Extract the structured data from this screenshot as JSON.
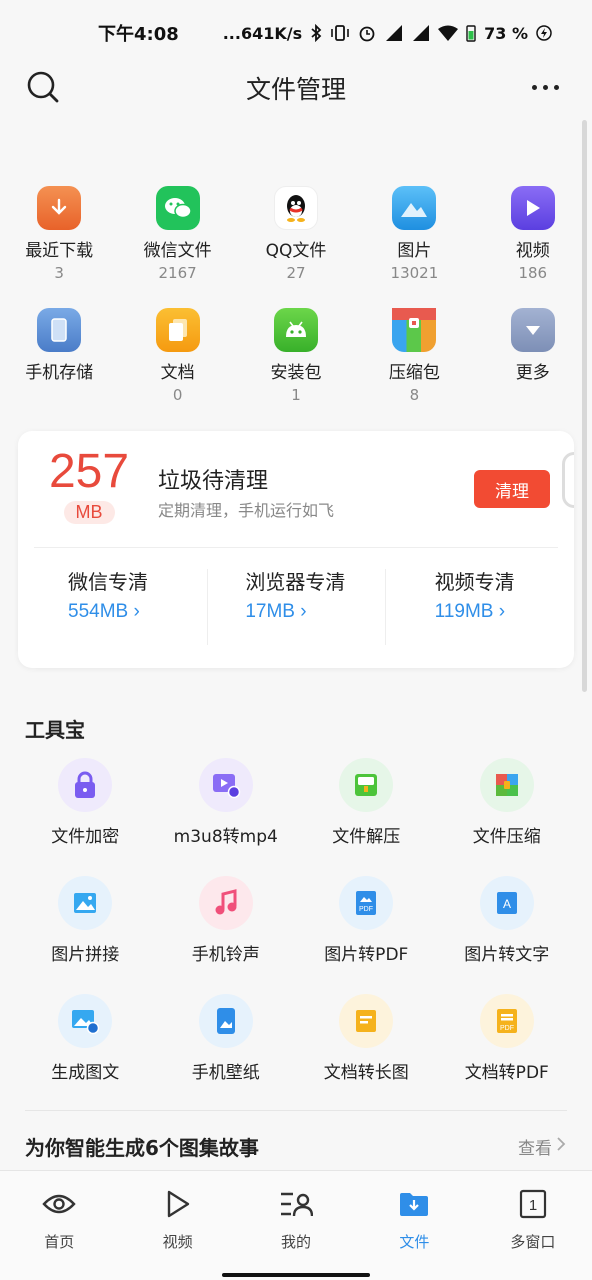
{
  "status_bar": {
    "time": "下午4:08",
    "net_speed": "...641K/s",
    "battery": "73"
  },
  "header": {
    "title": "文件管理"
  },
  "categories": [
    {
      "label": "最近下载",
      "count": "3",
      "icon": "download-icon",
      "color": "#f07a3e"
    },
    {
      "label": "微信文件",
      "count": "2167",
      "icon": "wechat-icon",
      "color": "#22c35b"
    },
    {
      "label": "QQ文件",
      "count": "27",
      "icon": "qq-icon",
      "color": "#ffffff"
    },
    {
      "label": "图片",
      "count": "13021",
      "icon": "image-icon",
      "color": "#35a8f0"
    },
    {
      "label": "视频",
      "count": "186",
      "icon": "video-icon",
      "color": "#7a5cf0"
    },
    {
      "label": "手机存储",
      "count": "",
      "icon": "phone-storage-icon",
      "color": "#5b8fd6"
    },
    {
      "label": "文档",
      "count": "0",
      "icon": "document-icon",
      "color": "#f5a623"
    },
    {
      "label": "安装包",
      "count": "1",
      "icon": "apk-icon",
      "color": "#4cc43a"
    },
    {
      "label": "压缩包",
      "count": "8",
      "icon": "zip-icon",
      "color": "#e85a4f"
    },
    {
      "label": "更多",
      "count": "",
      "icon": "more-icon",
      "color": "#8a9bc0"
    }
  ],
  "cleanup": {
    "size": "257",
    "unit": "MB",
    "title": "垃圾待清理",
    "subtitle": "定期清理，手机运行如飞",
    "button": "清理",
    "items": [
      {
        "label": "微信专清",
        "value": "554MB"
      },
      {
        "label": "浏览器专清",
        "value": "17MB"
      },
      {
        "label": "视频专清",
        "value": "119MB"
      }
    ]
  },
  "toolbox": {
    "title": "工具宝",
    "tools": [
      {
        "label": "文件加密",
        "icon": "lock-icon",
        "bg": "#efeafc"
      },
      {
        "label": "m3u8转mp4",
        "icon": "video-convert-icon",
        "bg": "#efeafc"
      },
      {
        "label": "文件解压",
        "icon": "unzip-icon",
        "bg": "#e6f6e8"
      },
      {
        "label": "文件压缩",
        "icon": "compress-icon",
        "bg": "#e6f6e8"
      },
      {
        "label": "图片拼接",
        "icon": "image-stitch-icon",
        "bg": "#e6f2fc"
      },
      {
        "label": "手机铃声",
        "icon": "ringtone-icon",
        "bg": "#fde8ec"
      },
      {
        "label": "图片转PDF",
        "icon": "image-pdf-icon",
        "bg": "#e6f2fc"
      },
      {
        "label": "图片转文字",
        "icon": "image-text-icon",
        "bg": "#e6f2fc"
      },
      {
        "label": "生成图文",
        "icon": "image-generate-icon",
        "bg": "#e6f2fc"
      },
      {
        "label": "手机壁纸",
        "icon": "wallpaper-icon",
        "bg": "#e6f2fc"
      },
      {
        "label": "文档转长图",
        "icon": "doc-longimage-icon",
        "bg": "#fdf3dc"
      },
      {
        "label": "文档转PDF",
        "icon": "doc-pdf-icon",
        "bg": "#fdf3dc"
      }
    ]
  },
  "story": {
    "title": "为你智能生成6个图集故事",
    "more": "查看"
  },
  "bottom_nav": [
    {
      "label": "首页",
      "icon": "eye-icon",
      "active": false
    },
    {
      "label": "视频",
      "icon": "play-icon",
      "active": false
    },
    {
      "label": "我的",
      "icon": "profile-icon",
      "active": false
    },
    {
      "label": "文件",
      "icon": "folder-icon",
      "active": true
    },
    {
      "label": "多窗口",
      "icon": "windows-icon",
      "active": false
    }
  ],
  "colors": {
    "accent": "#2f8ee8",
    "danger": "#f24b33"
  }
}
